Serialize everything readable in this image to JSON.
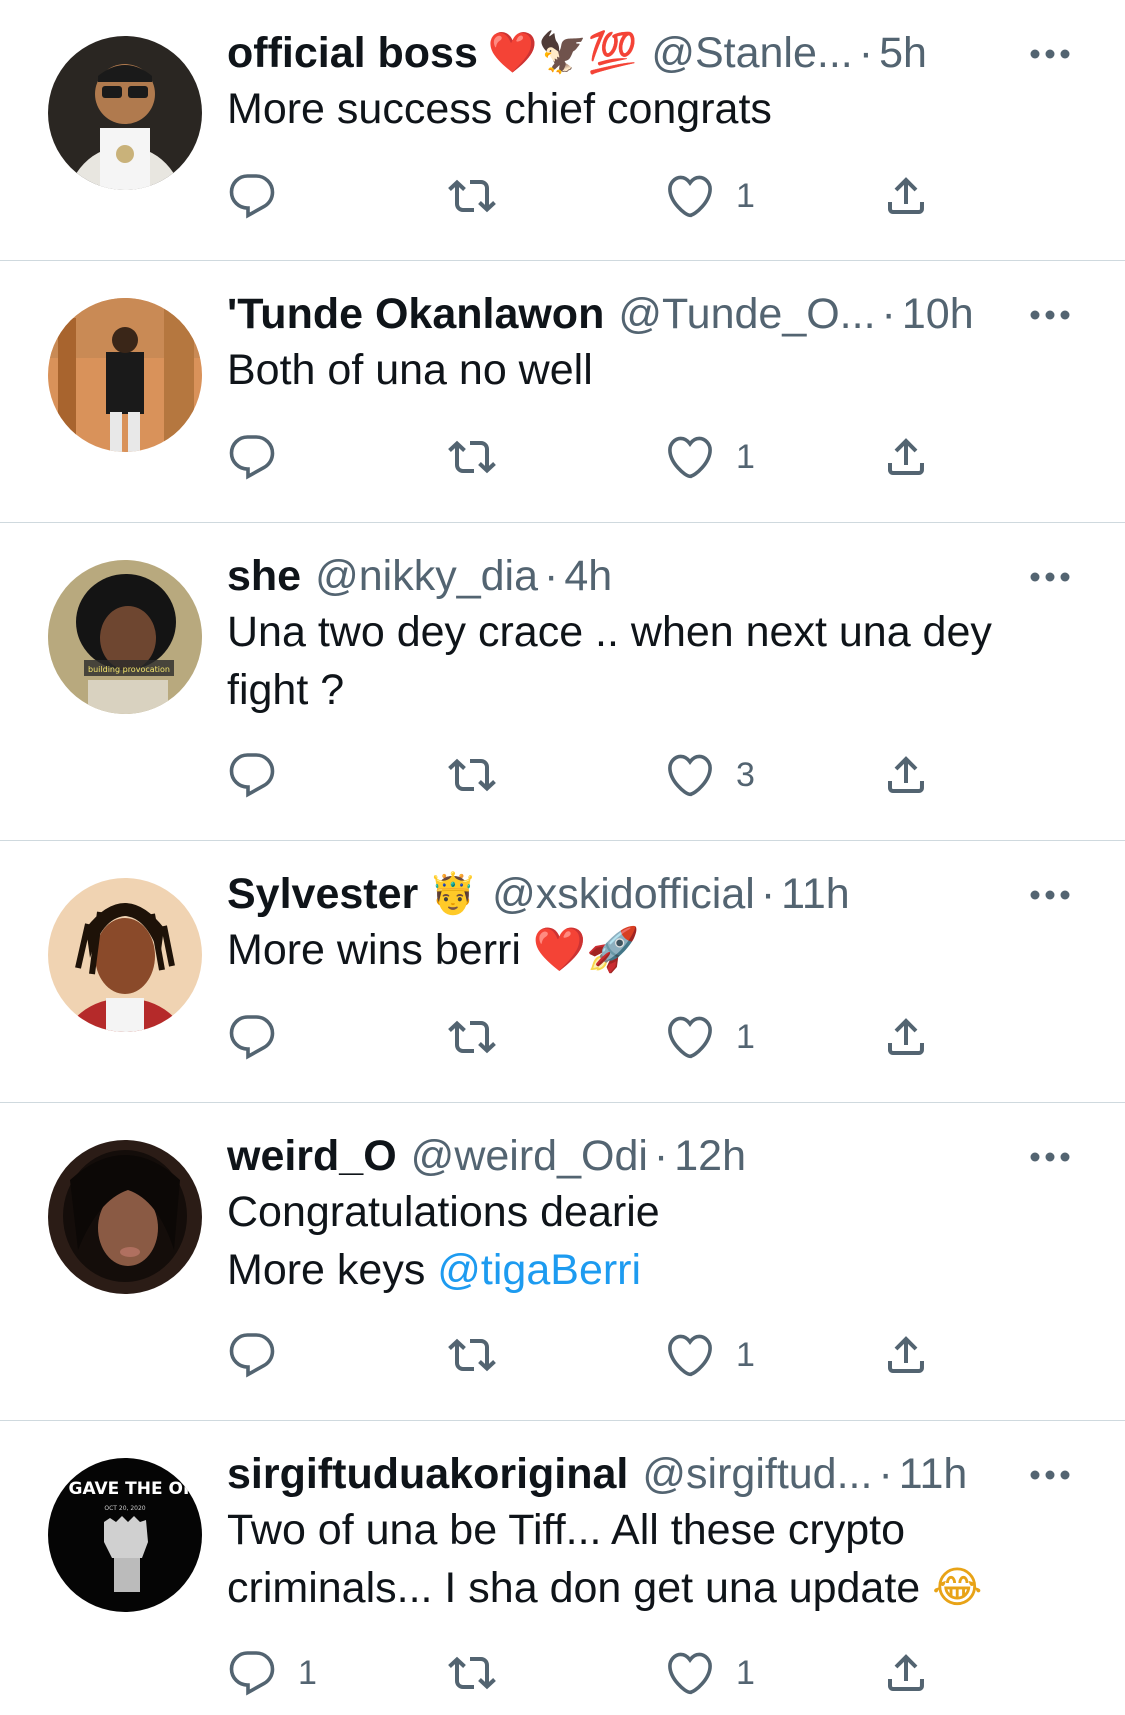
{
  "colors": {
    "text": "#0f1419",
    "secondary": "#536471",
    "link": "#1d9bf0",
    "divider": "#cfd9de"
  },
  "replies": [
    {
      "name": "official boss",
      "badges": "❤️🦅💯",
      "handle": "@Stanle...",
      "time": "5h",
      "lines": [
        "More success chief congrats"
      ],
      "reply_count": "",
      "like_count": "1"
    },
    {
      "name": "'Tunde Okanlawon",
      "badges": "",
      "handle": "@Tunde_O...",
      "time": "10h",
      "lines": [
        "Both of una no well"
      ],
      "reply_count": "",
      "like_count": "1"
    },
    {
      "name": "she",
      "badges": "",
      "handle": "@nikky_dia",
      "time": "4h",
      "lines": [
        "Una two dey crace .. when next una dey",
        "fight ?"
      ],
      "reply_count": "",
      "like_count": "3"
    },
    {
      "name": "Sylvester",
      "badges": "🤴",
      "handle": "@xskidofficial",
      "time": "11h",
      "lines": [
        "More wins berri"
      ],
      "line_emoji": "❤️🚀",
      "reply_count": "",
      "like_count": "1"
    },
    {
      "name": "weird_O",
      "badges": "",
      "handle": "@weird_Odi",
      "time": "12h",
      "lines": [
        "Congratulations dearie",
        "More keys "
      ],
      "mention": "@tigaBerri",
      "reply_count": "",
      "like_count": "1"
    },
    {
      "name": "sirgiftuduakoriginal",
      "badges": "",
      "handle": "@sirgiftud...",
      "time": "11h",
      "lines": [
        "Two of una be Tiff... All these crypto",
        "criminals... I sha don get una update "
      ],
      "line_emoji": "😂",
      "reply_count": "1",
      "like_count": "1"
    }
  ],
  "avatar_text": {
    "order_title": "WHO GAVE THE ORDER",
    "order_date": "OCT 20, 2020",
    "she_caption": "building provocation"
  },
  "icons": {
    "reply": "reply-icon",
    "retweet": "retweet-icon",
    "like": "like-icon",
    "share": "share-icon",
    "more": "more-icon"
  }
}
